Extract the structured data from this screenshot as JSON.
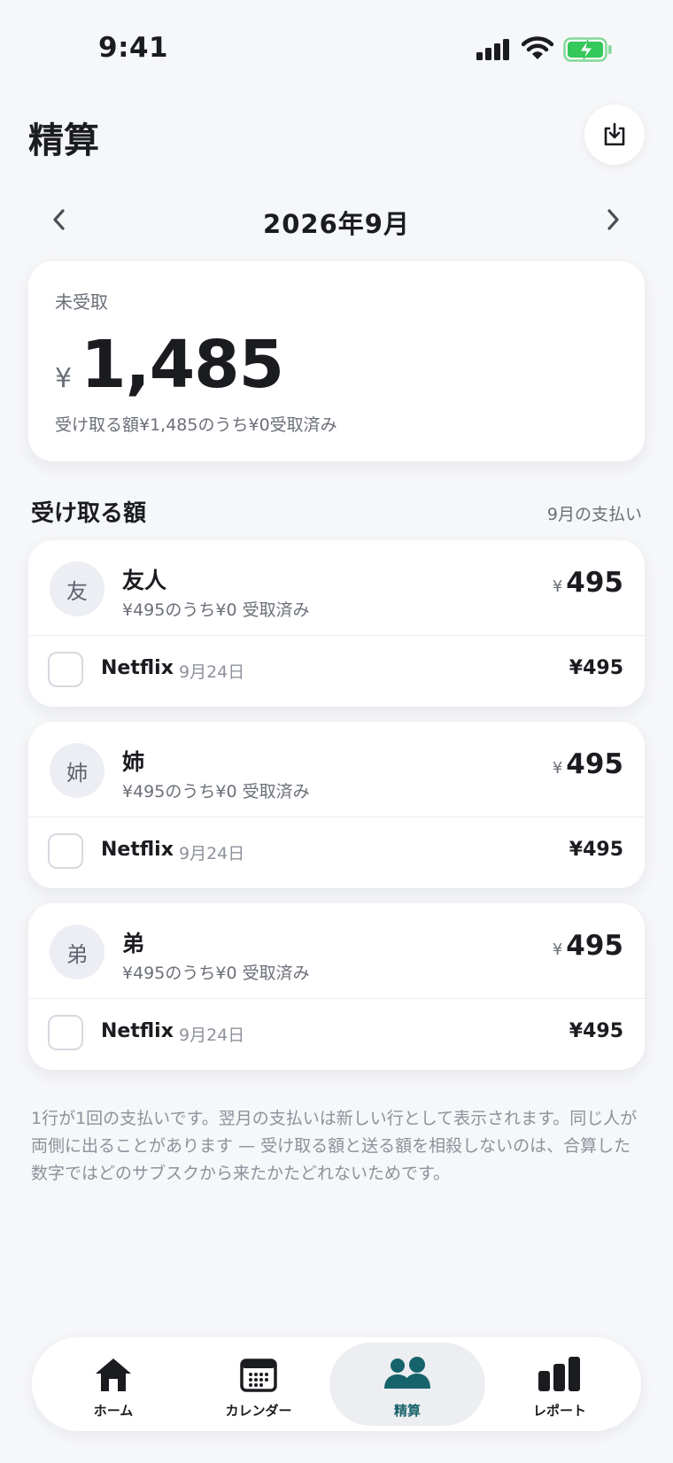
{
  "status_bar": {
    "time": "9:41"
  },
  "header": {
    "title": "精算",
    "export_icon": "download-tray-icon"
  },
  "month_nav": {
    "label": "2026年9月"
  },
  "summary": {
    "label": "未受取",
    "currency": "¥",
    "amount": "1,485",
    "subtext": "受け取る額¥1,485のうち¥0受取済み"
  },
  "section": {
    "title": "受け取る額",
    "note": "9月の支払い"
  },
  "people": [
    {
      "avatar": "友",
      "name": "友人",
      "subtext": "¥495のうち¥0 受取済み",
      "currency": "¥",
      "total": "495",
      "items": [
        {
          "name": "Netflix",
          "date": "9月24日",
          "amount": "¥495",
          "checked": false
        }
      ]
    },
    {
      "avatar": "姉",
      "name": "姉",
      "subtext": "¥495のうち¥0 受取済み",
      "currency": "¥",
      "total": "495",
      "items": [
        {
          "name": "Netflix",
          "date": "9月24日",
          "amount": "¥495",
          "checked": false
        }
      ]
    },
    {
      "avatar": "弟",
      "name": "弟",
      "subtext": "¥495のうち¥0 受取済み",
      "currency": "¥",
      "total": "495",
      "items": [
        {
          "name": "Netflix",
          "date": "9月24日",
          "amount": "¥495",
          "checked": false
        }
      ]
    }
  ],
  "footnote": "1行が1回の支払いです。翌月の支払いは新しい行として表示されます。同じ人が両側に出ることがあります — 受け取る額と送る額を相殺しないのは、合算した数字ではどのサブスクから来たかたどれないためです。",
  "tabs": [
    {
      "label": "ホーム",
      "icon": "home-icon",
      "active": false
    },
    {
      "label": "カレンダー",
      "icon": "calendar-icon",
      "active": false
    },
    {
      "label": "精算",
      "icon": "people-icon",
      "active": true
    },
    {
      "label": "レポート",
      "icon": "bar-chart-icon",
      "active": false
    }
  ],
  "colors": {
    "accent": "#17636b",
    "background": "#f6f7f9",
    "battery": "#34c759"
  }
}
